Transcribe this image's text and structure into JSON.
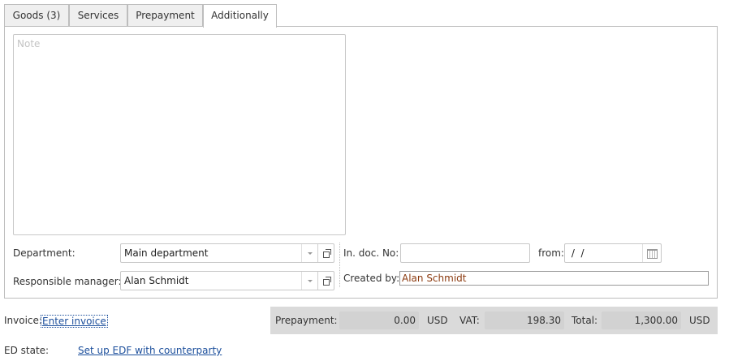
{
  "tabs": [
    {
      "label": "Goods (3)"
    },
    {
      "label": "Services"
    },
    {
      "label": "Prepayment"
    },
    {
      "label": "Additionally"
    }
  ],
  "note": {
    "placeholder": "Note",
    "value": ""
  },
  "department": {
    "label": "Department:",
    "value": "Main department"
  },
  "responsible_manager": {
    "label": "Responsible manager:",
    "value": "Alan Schmidt"
  },
  "in_doc": {
    "label": "In. doc. No:",
    "value": "",
    "from_label": "from:",
    "date_value": " /  /"
  },
  "created_by": {
    "label": "Created by:",
    "value": "Alan Schmidt"
  },
  "invoice": {
    "label": "Invoice:",
    "link": "Enter invoice"
  },
  "ed_state": {
    "label": "ED state:",
    "link": "Set up EDF with counterparty"
  },
  "totals": {
    "prepayment_label": "Prepayment:",
    "prepayment_value": "0.00",
    "prepayment_currency": "USD",
    "vat_label": "VAT:",
    "vat_value": "198.30",
    "total_label": "Total:",
    "total_value": "1,300.00",
    "total_currency": "USD"
  },
  "colors": {
    "link": "#1c4f9c",
    "created_by_text": "#8b3a0f",
    "summary_bg": "#dadada"
  }
}
